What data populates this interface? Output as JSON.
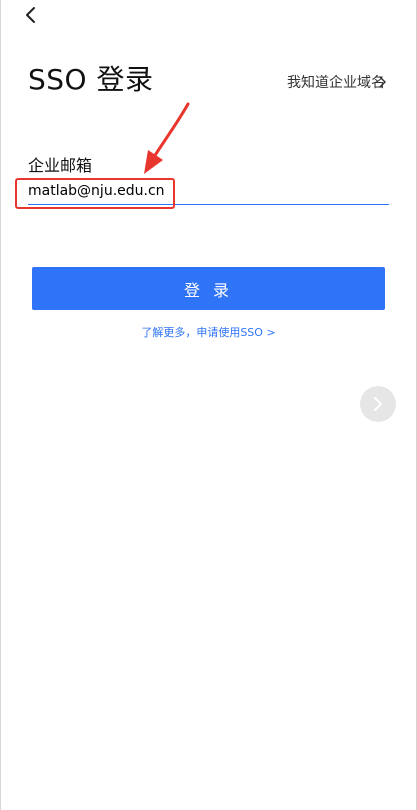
{
  "header": {
    "back_icon": "chevron-left-icon"
  },
  "page": {
    "title": "SSO 登录",
    "domain_link": "我知道企业域名",
    "domain_link_icon": "chevron-right-icon"
  },
  "form": {
    "email_label": "企业邮箱",
    "email_value": "matlab@nju.edu.cn",
    "login_label": "登 录",
    "learn_more": "了解更多，申请使用SSO >"
  },
  "next_button": {
    "icon": "chevron-right-icon"
  },
  "colors": {
    "primary": "#2f73f6",
    "annotation_red": "#e8362e",
    "next_circle_bg": "#e6e6e6"
  }
}
